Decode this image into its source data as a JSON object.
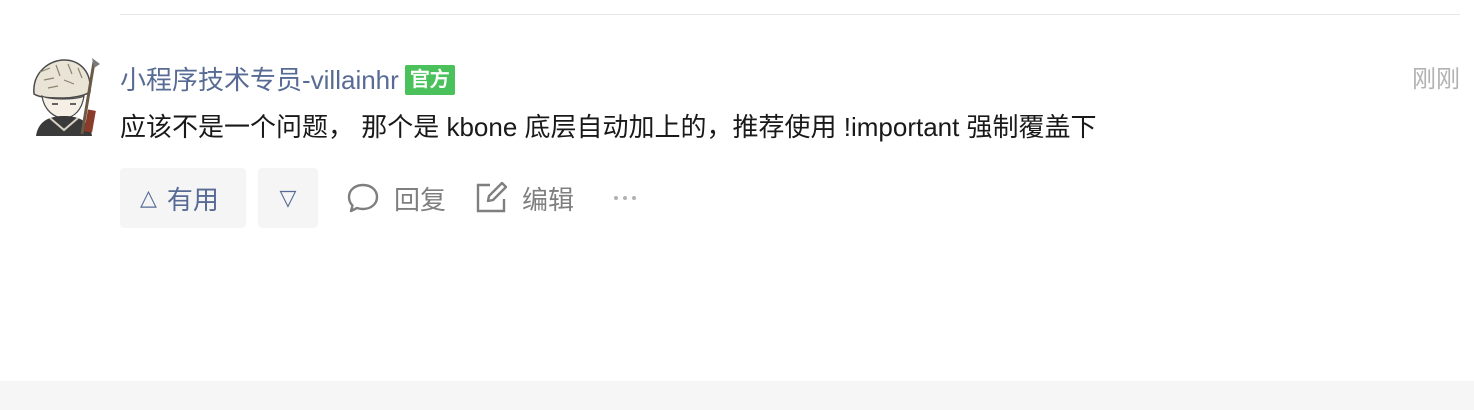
{
  "comment": {
    "author": {
      "name": "小程序技术专员-villainhr",
      "badge": "官方"
    },
    "time": "刚刚",
    "content": "应该不是一个问题， 那个是 kbone 底层自动加上的，推荐使用 !important 强制覆盖下",
    "actions": {
      "useful_icon": "△",
      "useful_label": "有用",
      "not_useful_icon": "▽",
      "reply_label": "回复",
      "edit_label": "编辑"
    }
  },
  "colors": {
    "link": "#576b95",
    "badge_bg": "#4ac15a",
    "muted": "#b2b2b2",
    "text": "#191919"
  },
  "icons": {
    "reply": "speech-bubble-icon",
    "edit": "edit-pencil-icon",
    "more": "more-dots-icon"
  }
}
